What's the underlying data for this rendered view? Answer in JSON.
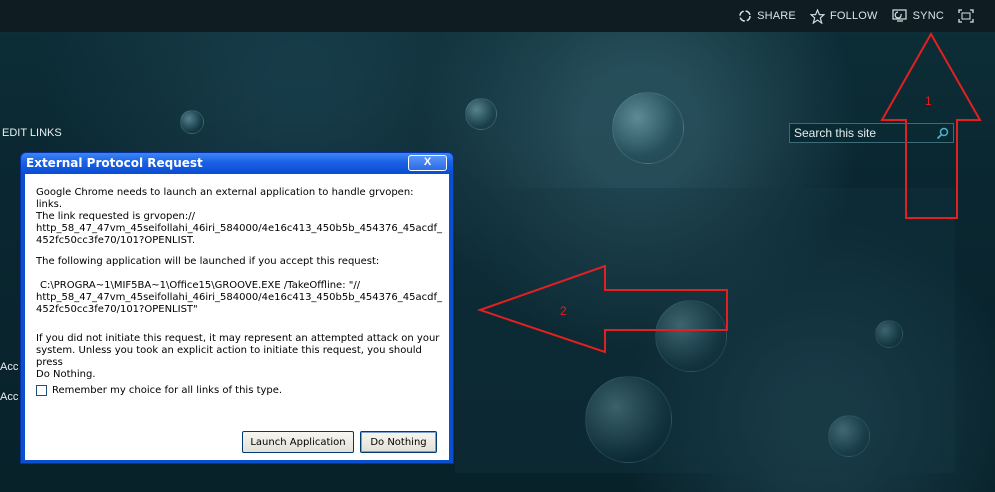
{
  "topbar": {
    "actions": [
      {
        "label": "SHARE",
        "icon": "share-icon"
      },
      {
        "label": "FOLLOW",
        "icon": "star-icon"
      },
      {
        "label": "SYNC",
        "icon": "sync-icon"
      }
    ],
    "focus_icon": "focus-icon"
  },
  "nav": {
    "edit_links": "EDIT LINKS"
  },
  "search": {
    "placeholder": "Search this site"
  },
  "side": {
    "item1": "Acc",
    "item2": "Acc"
  },
  "dialog": {
    "title": "External Protocol Request",
    "close_label": "X",
    "para1_line1": "Google Chrome needs to launch an external application to handle grvopen: links.",
    "para1_line2": "The link requested is grvopen://",
    "para1_line3": "http_58_47_47vm_45seifollahi_46iri_584000/4e16c413_450b5b_454376_45acdf_",
    "para1_line4": "452fc50cc3fe70/101?OPENLIST.",
    "para2": "The following application will be launched if you accept this request:",
    "para3_line1": "C:\\PROGRA~1\\MIF5BA~1\\Office15\\GROOVE.EXE /TakeOffline: \"//",
    "para3_line2": "http_58_47_47vm_45seifollahi_46iri_584000/4e16c413_450b5b_454376_45acdf_",
    "para3_line3": "452fc50cc3fe70/101?OPENLIST\"",
    "para4_line1": "If you did not initiate this request, it may represent an attempted attack on your",
    "para4_line2": "system. Unless you took an explicit action to initiate this request, you should press",
    "para4_line3": "Do Nothing.",
    "checkbox_label": "Remember my choice for all links of this type.",
    "checkbox_checked": false,
    "launch_button": "Launch Application",
    "nothing_button": "Do Nothing"
  },
  "annotations": {
    "label1": "1",
    "label2": "2",
    "color": "#e32020"
  }
}
